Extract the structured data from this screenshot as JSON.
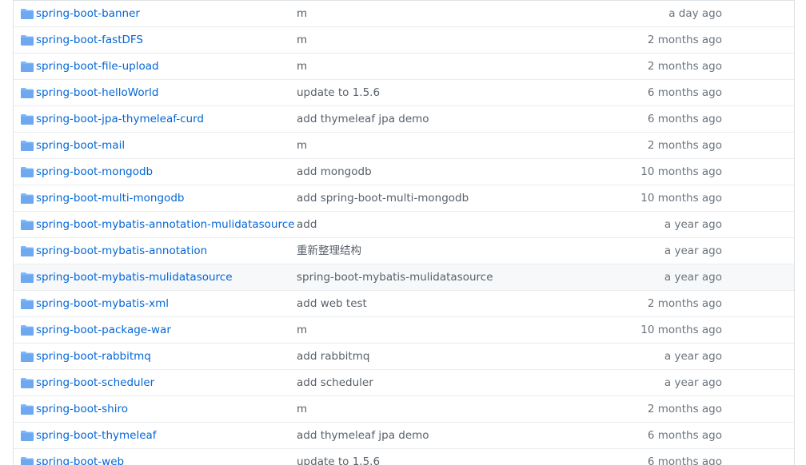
{
  "icon": "folder-icon",
  "colors": {
    "link": "#0366d6",
    "message": "#586069",
    "age": "#6a737d",
    "folder": "#79b8ff"
  },
  "rows": [
    {
      "name": "spring-boot-banner",
      "message": "m",
      "age": "a day ago"
    },
    {
      "name": "spring-boot-fastDFS",
      "message": "m",
      "age": "2 months ago"
    },
    {
      "name": "spring-boot-file-upload",
      "message": "m",
      "age": "2 months ago"
    },
    {
      "name": "spring-boot-helloWorld",
      "message": "update to 1.5.6",
      "age": "6 months ago"
    },
    {
      "name": "spring-boot-jpa-thymeleaf-curd",
      "message": "add thymeleaf jpa demo",
      "age": "6 months ago"
    },
    {
      "name": "spring-boot-mail",
      "message": "m",
      "age": "2 months ago"
    },
    {
      "name": "spring-boot-mongodb",
      "message": "add mongodb",
      "age": "10 months ago"
    },
    {
      "name": "spring-boot-multi-mongodb",
      "message": "add spring-boot-multi-mongodb",
      "age": "10 months ago"
    },
    {
      "name": "spring-boot-mybatis-annotation-mulidatasource",
      "message": "add",
      "age": "a year ago"
    },
    {
      "name": "spring-boot-mybatis-annotation",
      "message": "重新整理结构",
      "age": "a year ago"
    },
    {
      "name": "spring-boot-mybatis-mulidatasource",
      "message": "spring-boot-mybatis-mulidatasource",
      "age": "a year ago"
    },
    {
      "name": "spring-boot-mybatis-xml",
      "message": "add web test",
      "age": "2 months ago"
    },
    {
      "name": "spring-boot-package-war",
      "message": "m",
      "age": "10 months ago"
    },
    {
      "name": "spring-boot-rabbitmq",
      "message": "add rabbitmq",
      "age": "a year ago"
    },
    {
      "name": "spring-boot-scheduler",
      "message": "add scheduler",
      "age": "a year ago"
    },
    {
      "name": "spring-boot-shiro",
      "message": "m",
      "age": "2 months ago"
    },
    {
      "name": "spring-boot-thymeleaf",
      "message": "add thymeleaf jpa demo",
      "age": "6 months ago"
    },
    {
      "name": "spring-boot-web",
      "message": "update to 1.5.6",
      "age": "6 months ago"
    }
  ]
}
